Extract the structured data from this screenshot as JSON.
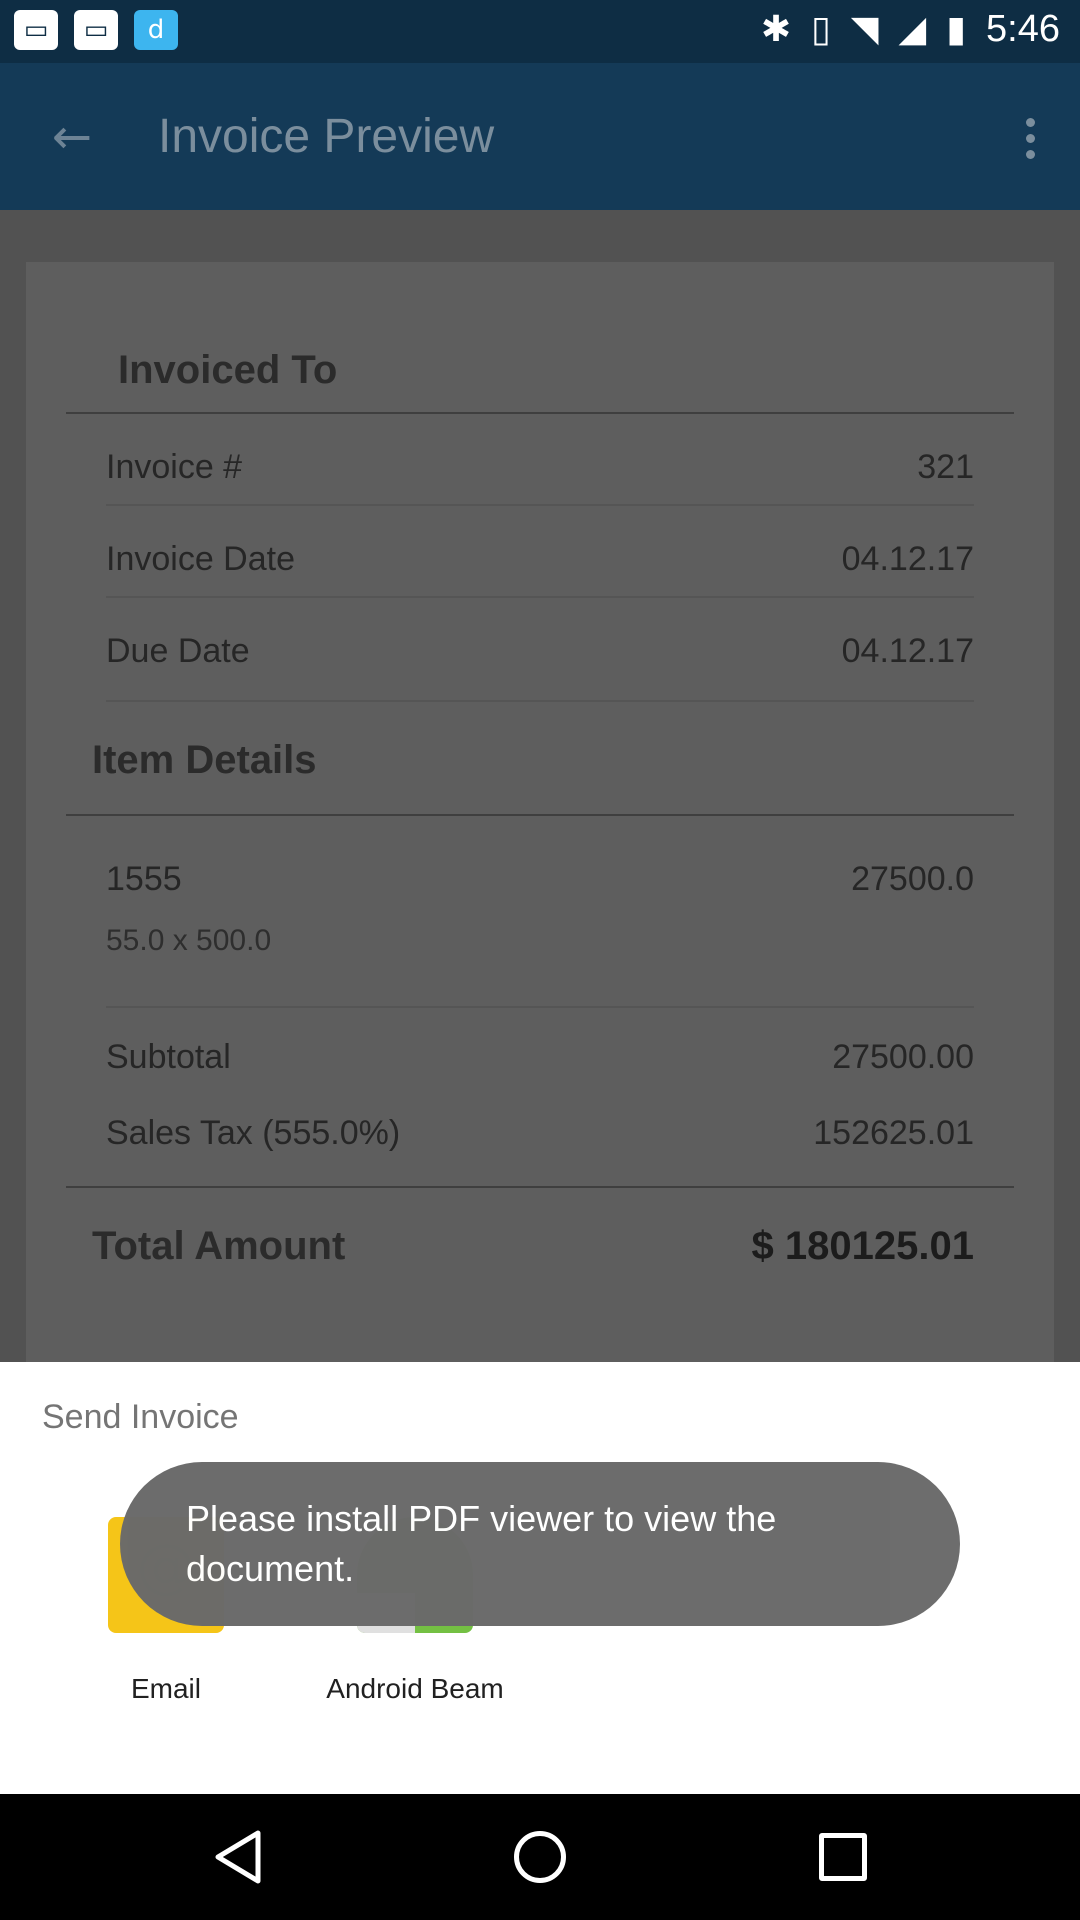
{
  "status_bar": {
    "time": "5:46",
    "left_icons": [
      "gallery-icon",
      "gallery-icon",
      "dict-icon"
    ],
    "right_icons": [
      "bluetooth-icon",
      "vibrate-icon",
      "wifi-icon",
      "signal-icon",
      "battery-icon"
    ]
  },
  "app_bar": {
    "title": "Invoice Preview",
    "back_icon": "arrow-back-icon",
    "more_icon": "more-vert-icon"
  },
  "invoice": {
    "invoiced_to": {
      "title": "Invoiced To",
      "rows": [
        {
          "label": "Invoice #",
          "value": "321"
        },
        {
          "label": "Invoice Date",
          "value": "04.12.17"
        },
        {
          "label": "Due Date",
          "value": "04.12.17"
        }
      ]
    },
    "item_details": {
      "title": "Item Details",
      "item": {
        "name": "1555",
        "amount": "27500.0",
        "detail": "55.0 x 500.0"
      },
      "subtotal": {
        "label": "Subtotal",
        "value": "27500.00"
      },
      "tax": {
        "label": "Sales Tax (555.0%)",
        "value": "152625.01"
      }
    },
    "total": {
      "label": "Total Amount",
      "value": "$ 180125.01"
    }
  },
  "share_sheet": {
    "title": "Send Invoice",
    "items": [
      {
        "label": "Email",
        "icon": "email-icon"
      },
      {
        "label": "Android Beam",
        "icon": "android-beam-icon"
      }
    ]
  },
  "toast": {
    "message": "Please install PDF viewer to view the document."
  },
  "colors": {
    "app_bar": "#143a57",
    "status_bar": "#0e2d44",
    "scrim": "#525252",
    "sheet": "#ffffff"
  }
}
